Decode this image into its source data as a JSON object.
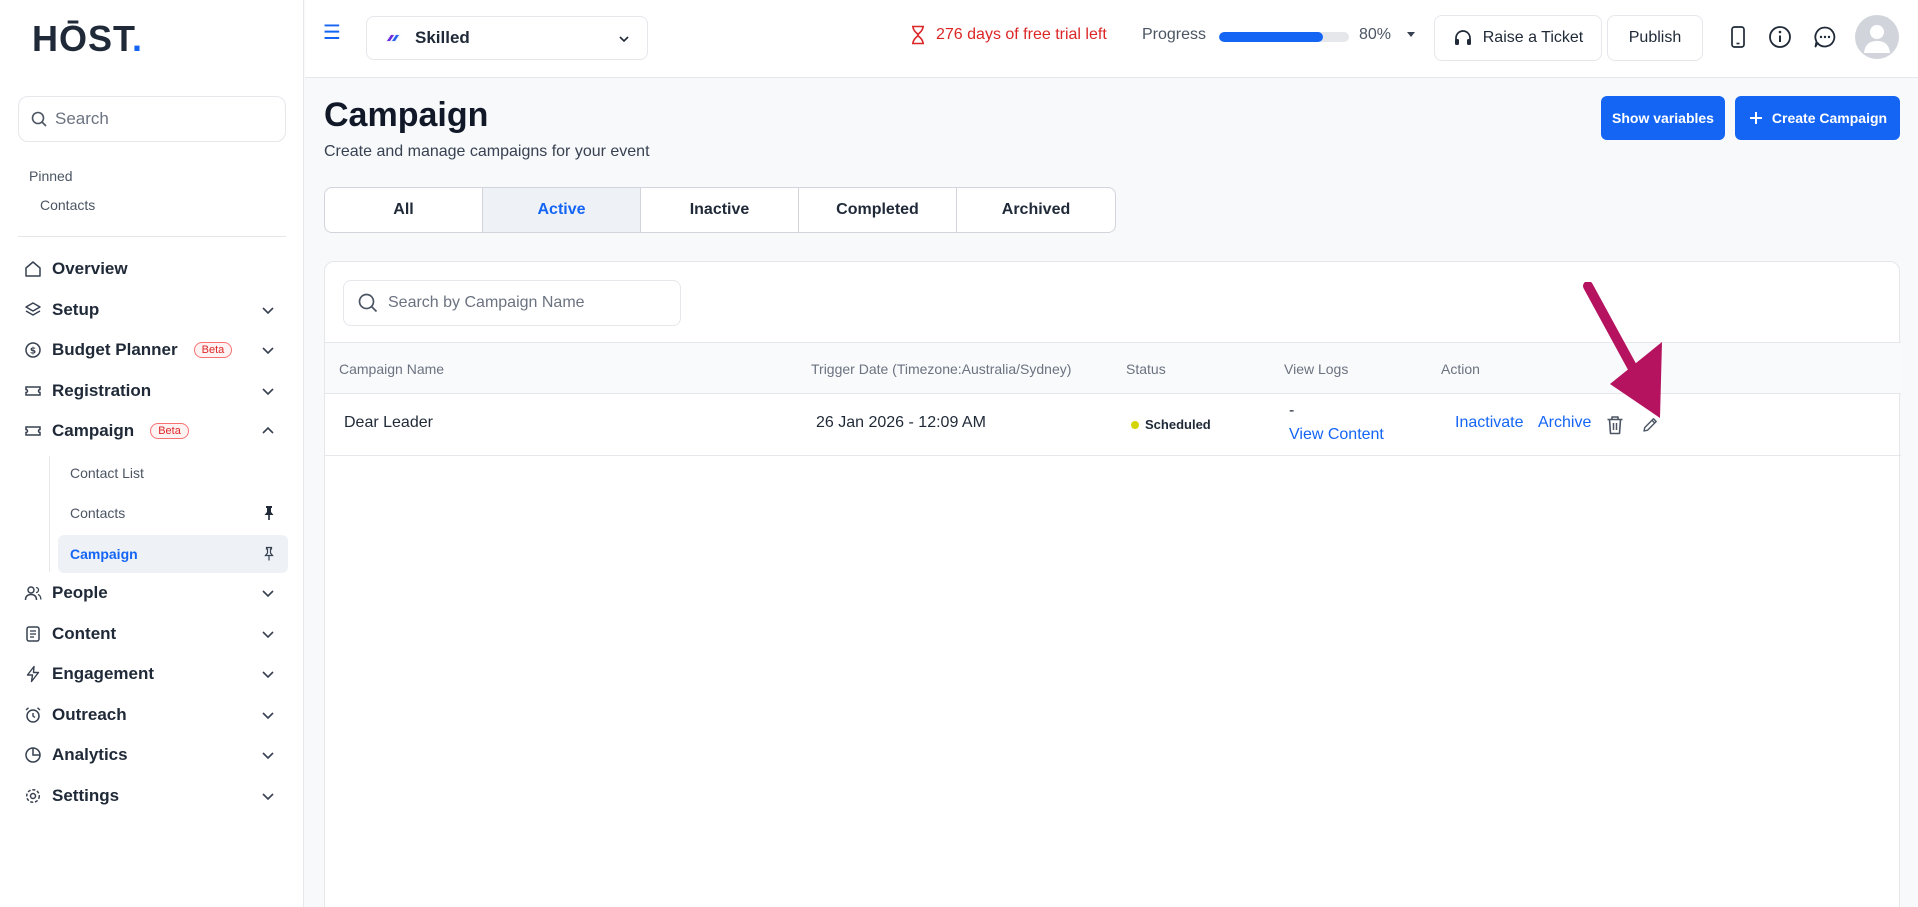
{
  "sidebar": {
    "logo_main": "HŌST",
    "logo_dot": ".",
    "search_placeholder": "Search",
    "pinned_title": "Pinned",
    "pinned_items": [
      "Contacts"
    ],
    "items": [
      {
        "label": "Overview"
      },
      {
        "label": "Setup"
      },
      {
        "label": "Budget Planner",
        "badge": "Beta"
      },
      {
        "label": "Registration"
      },
      {
        "label": "Campaign",
        "badge": "Beta"
      },
      {
        "label": "People"
      },
      {
        "label": "Content"
      },
      {
        "label": "Engagement"
      },
      {
        "label": "Outreach"
      },
      {
        "label": "Analytics"
      },
      {
        "label": "Settings"
      }
    ],
    "campaign_subitems": [
      {
        "label": "Contact List"
      },
      {
        "label": "Contacts"
      },
      {
        "label": "Campaign"
      }
    ]
  },
  "topbar": {
    "event_name": "Skilled",
    "trial_text": "276 days of free trial left",
    "progress_label": "Progress",
    "progress_value": "80%",
    "progress_fraction": 0.8,
    "raise_ticket": "Raise a Ticket",
    "publish": "Publish"
  },
  "main": {
    "title": "Campaign",
    "subtitle": "Create and manage campaigns for your event",
    "show_variables": "Show variables",
    "create_campaign": "Create Campaign",
    "tabs": [
      {
        "label": "All"
      },
      {
        "label": "Active"
      },
      {
        "label": "Inactive"
      },
      {
        "label": "Completed"
      },
      {
        "label": "Archived"
      }
    ],
    "table": {
      "search_placeholder": "Search by Campaign Name",
      "columns": [
        "Campaign Name",
        "Trigger Date (Timezone:Australia/Sydney)",
        "Status",
        "View Logs",
        "Action"
      ],
      "rows": [
        {
          "name": "Dear Leader",
          "trigger_date": "26 Jan 2026 - 12:09 AM",
          "status": "Scheduled",
          "view_logs_dash": "-",
          "view_content": "View Content",
          "action_inactivate": "Inactivate",
          "action_archive": "Archive"
        }
      ]
    }
  },
  "colors": {
    "accent": "#1565f5",
    "trial_red": "#dc2626",
    "status_scheduled": "#d4d40a",
    "annotation_arrow": "#b5125f"
  }
}
